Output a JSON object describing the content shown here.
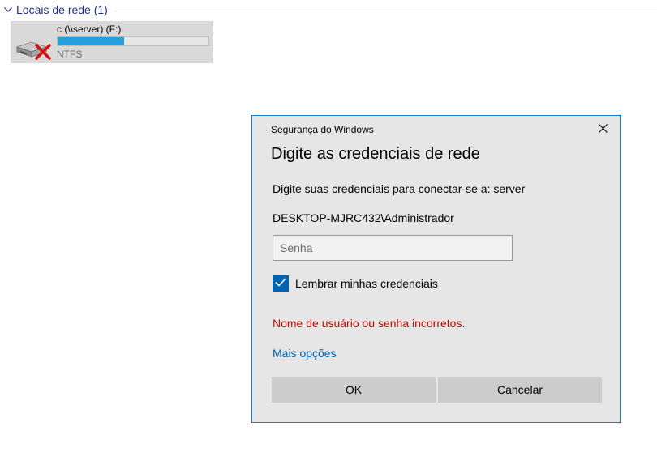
{
  "explorer": {
    "group": {
      "title": "Locais de rede (1)",
      "chevron_icon": "chevron-down-icon"
    },
    "drive": {
      "name": "c (\\\\server) (F:)",
      "filesystem": "NTFS",
      "usage_fraction": 0.44,
      "bar_color": "#26a0da",
      "icon": "disconnected-network-drive-icon"
    }
  },
  "dialog": {
    "caption": "Segurança do Windows",
    "title": "Digite as credenciais de rede",
    "prompt": "Digite suas credenciais para conectar-se a: server",
    "user": "DESKTOP-MJRC432\\Administrador",
    "password": {
      "value": "",
      "placeholder": "Senha"
    },
    "remember": {
      "label": "Lembrar minhas credenciais",
      "checked": true
    },
    "error": "Nome de usuário ou senha incorretos.",
    "more_options": "Mais opções",
    "buttons": {
      "ok": "OK",
      "cancel": "Cancelar"
    },
    "colors": {
      "accent": "#0063b1",
      "border": "#1979ca",
      "error": "#c50500"
    }
  }
}
